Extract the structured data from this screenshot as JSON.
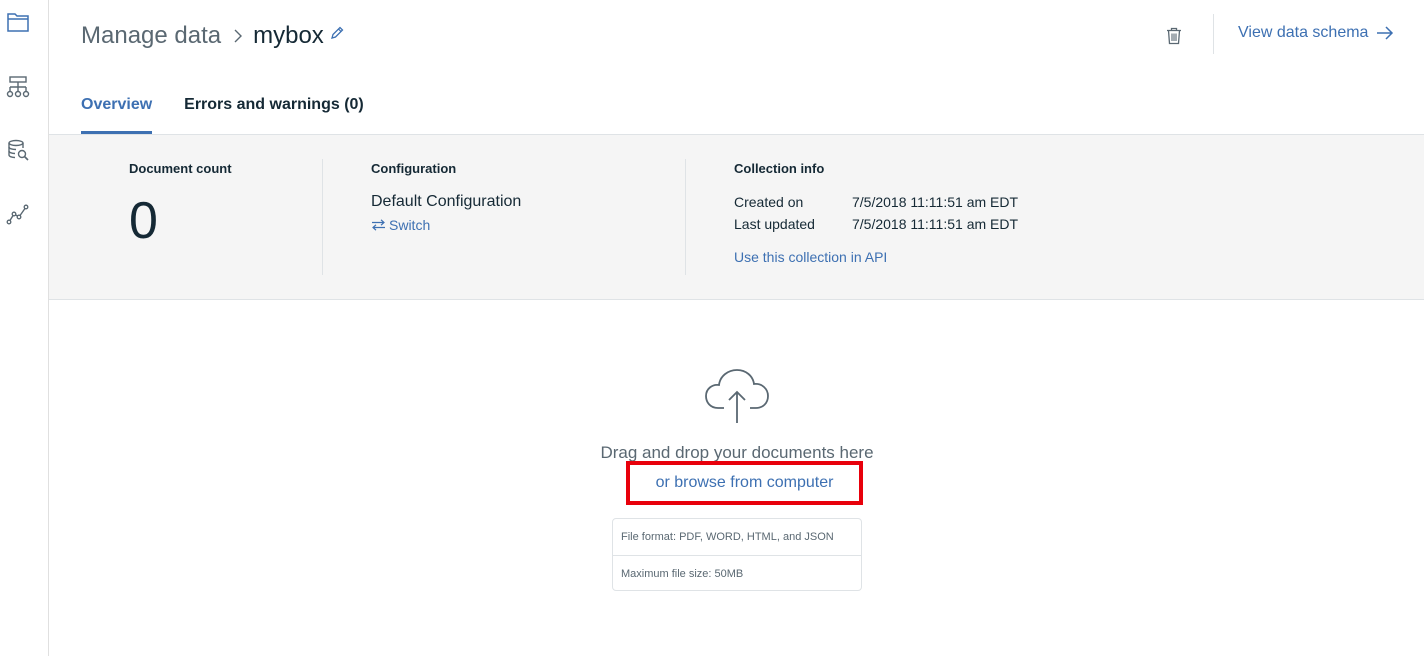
{
  "rail": {
    "items": [
      {
        "name": "manage-data-icon",
        "active": true
      },
      {
        "name": "build-queries-icon",
        "active": false
      },
      {
        "name": "search-data-icon",
        "active": false
      },
      {
        "name": "analytics-icon",
        "active": false
      }
    ]
  },
  "header": {
    "breadcrumb_parent": "Manage data",
    "breadcrumb_current": "mybox",
    "view_schema_label": "View data schema"
  },
  "tabs": [
    {
      "label": "Overview",
      "active": true
    },
    {
      "label": "Errors and warnings (0)",
      "active": false
    }
  ],
  "summary": {
    "document_count_label": "Document count",
    "document_count": "0",
    "configuration_label": "Configuration",
    "configuration_name": "Default Configuration",
    "switch_label": "Switch",
    "collection_info_label": "Collection info",
    "created_on_label": "Created on",
    "created_on_value": "7/5/2018 11:11:51 am EDT",
    "last_updated_label": "Last updated",
    "last_updated_value": "7/5/2018 11:11:51 am EDT",
    "api_link_label": "Use this collection in API"
  },
  "upload": {
    "drop_text": "Drag and drop your documents here",
    "browse_label": "or browse from computer",
    "file_format_text": "File format: PDF, WORD, HTML, and JSON",
    "max_size_text": "Maximum file size: 50MB"
  },
  "colors": {
    "accent": "#3d70b2",
    "highlight_box": "#e8000b",
    "panel_bg": "#f5f5f5"
  }
}
